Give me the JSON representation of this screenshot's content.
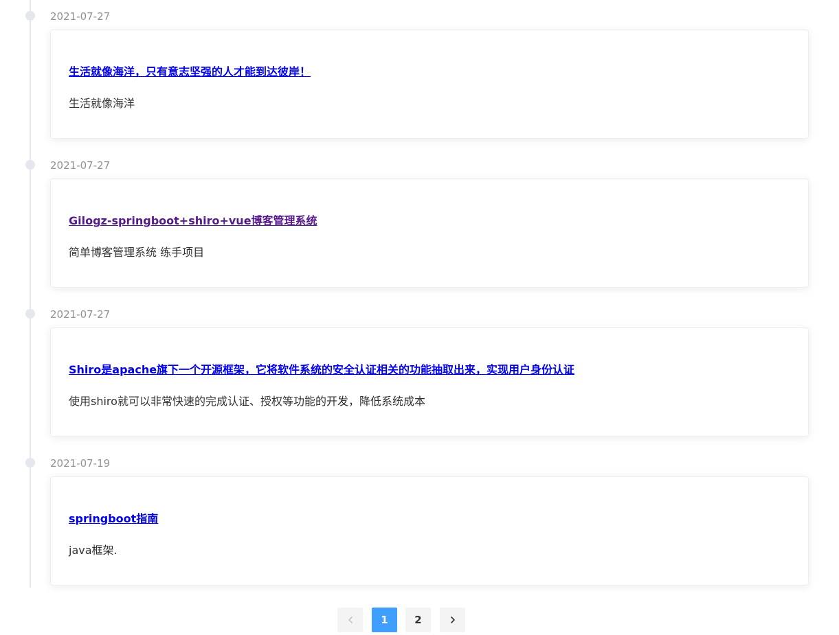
{
  "posts": [
    {
      "date": "2021-07-27",
      "title": "生活就像海洋，只有意志坚强的人才能到达彼岸！",
      "description": "生活就像海洋"
    },
    {
      "date": "2021-07-27",
      "title": "Gilogz-springboot+shiro+vue博客管理系统",
      "description": "简单博客管理系统 练手项目"
    },
    {
      "date": "2021-07-27",
      "title": "Shiro是apache旗下一个开源框架，它将软件系统的安全认证相关的功能抽取出来，实现用户身份认证",
      "description": "使用shiro就可以非常快速的完成认证、授权等功能的开发，降低系统成本"
    },
    {
      "date": "2021-07-19",
      "title": "springboot指南",
      "description": "java框架."
    }
  ],
  "pagination": {
    "prev_icon": "chevron-left-icon",
    "next_icon": "chevron-right-icon",
    "pages": [
      "1",
      "2"
    ],
    "current_page": "1"
  },
  "colors": {
    "link": "#0000ee",
    "visited_link": "#551a8b",
    "active_page": "#409eff",
    "timeline": "#e4e7ed",
    "date_text": "#909399"
  }
}
